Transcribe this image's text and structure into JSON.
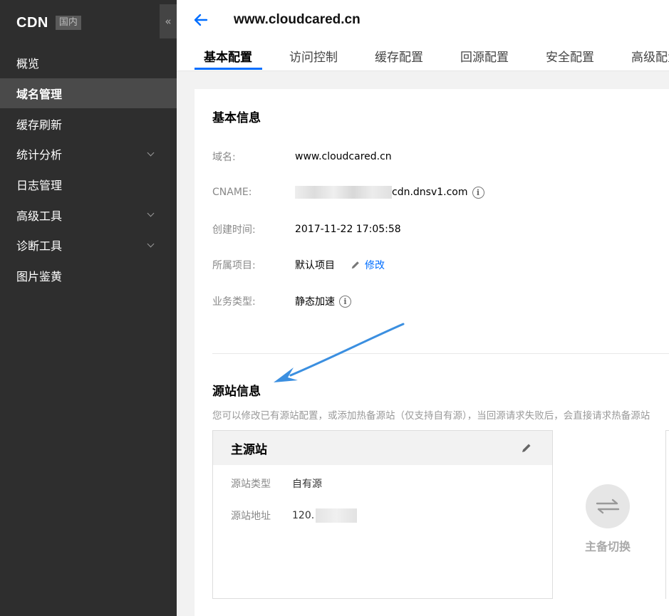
{
  "sidebar": {
    "brand": "CDN",
    "region": "国内",
    "collapse_icon": "«",
    "items": [
      {
        "label": "概览",
        "has_children": false,
        "active": false
      },
      {
        "label": "域名管理",
        "has_children": false,
        "active": true
      },
      {
        "label": "缓存刷新",
        "has_children": false,
        "active": false
      },
      {
        "label": "统计分析",
        "has_children": true,
        "active": false
      },
      {
        "label": "日志管理",
        "has_children": false,
        "active": false
      },
      {
        "label": "高级工具",
        "has_children": true,
        "active": false
      },
      {
        "label": "诊断工具",
        "has_children": true,
        "active": false
      },
      {
        "label": "图片鉴黄",
        "has_children": false,
        "active": false
      }
    ]
  },
  "header": {
    "domain": "www.cloudcared.cn",
    "tabs": [
      "基本配置",
      "访问控制",
      "缓存配置",
      "回源配置",
      "安全配置",
      "高级配置"
    ],
    "active_tab": 0
  },
  "basic_info": {
    "title": "基本信息",
    "domain_label": "域名:",
    "domain_value": "www.cloudcared.cn",
    "cname_label": "CNAME:",
    "cname_suffix": "cdn.dnsv1.com",
    "created_label": "创建时间:",
    "created_value": "2017-11-22 17:05:58",
    "project_label": "所属项目:",
    "project_value": "默认项目",
    "project_edit": "修改",
    "biz_label": "业务类型:",
    "biz_value": "静态加速",
    "info_glyph": "i"
  },
  "origin_info": {
    "title": "源站信息",
    "description": "您可以修改已有源站配置，或添加热备源站（仅支持自有源），当回源请求失败后，会直接请求热备源站",
    "primary": {
      "title": "主源站",
      "type_label": "源站类型",
      "type_value": "自有源",
      "addr_label": "源站地址",
      "addr_value": "120."
    },
    "switch_label": "主备切换"
  },
  "colors": {
    "accent": "#006eff",
    "sidebar_bg": "#2e2e2e",
    "annotation_arrow": "#3b8fe0"
  }
}
